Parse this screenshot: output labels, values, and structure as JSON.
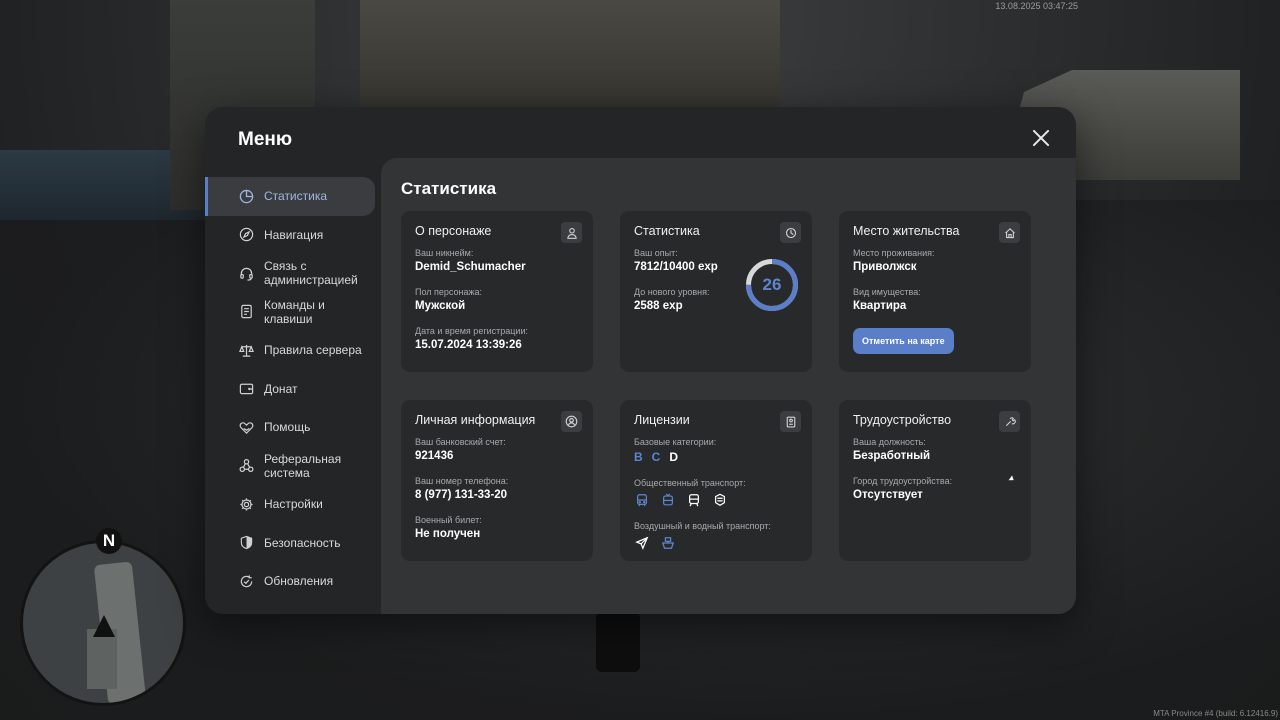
{
  "hud": {
    "datetime": "13.08.2025 03:47:25",
    "build": "MTA Province #4 (build: 6.12416.9)",
    "radar_north": "N"
  },
  "menu": {
    "title": "Меню",
    "sidebar": [
      {
        "label": "Статистика",
        "icon": "pie-chart-icon",
        "active": true
      },
      {
        "label": "Навигация",
        "icon": "compass-icon"
      },
      {
        "label": "Связь с\nадминистрацией",
        "icon": "headset-icon"
      },
      {
        "label": "Команды и\nклавиши",
        "icon": "document-icon"
      },
      {
        "label": "Правила сервера",
        "icon": "scales-icon"
      },
      {
        "label": "Донат",
        "icon": "wallet-icon"
      },
      {
        "label": "Помощь",
        "icon": "handshake-heart-icon"
      },
      {
        "label": "Реферальная\nсистема",
        "icon": "network-icon"
      },
      {
        "label": "Настройки",
        "icon": "gear-icon"
      },
      {
        "label": "Безопасность",
        "icon": "shield-icon"
      },
      {
        "label": "Обновления",
        "icon": "refresh-check-icon"
      }
    ],
    "section_title": "Статистика",
    "cards": {
      "character": {
        "title": "О персонаже",
        "icon": "user-icon",
        "nickname_label": "Ваш никнейм:",
        "nickname": "Demid_Schumacher",
        "gender_label": "Пол персонажа:",
        "gender": "Мужской",
        "reg_label": "Дата и время регистрации:",
        "reg_date": "15.07.2024 13:39:26"
      },
      "stats": {
        "title": "Статистика",
        "icon": "clock-chart-icon",
        "exp_label": "Ваш опыт:",
        "exp": "7812/10400 exp",
        "next_label": "До нового уровня:",
        "next": "2588 exp",
        "level": "26",
        "progress": 0.751
      },
      "residence": {
        "title": "Место жительства",
        "icon": "home-icon",
        "place_label": "Место проживания:",
        "place": "Приволжск",
        "property_label": "Вид имущества:",
        "property": "Квартира",
        "map_button": "Отметить на карте"
      },
      "personal": {
        "title": "Личная информация",
        "icon": "person-circle-icon",
        "bank_label": "Ваш банковский счет:",
        "bank": "921436",
        "phone_label": "Ваш номер телефона:",
        "phone": "8 (977) 131-33-20",
        "military_label": "Военный билет:",
        "military": "Не получен"
      },
      "licenses": {
        "title": "Лицензии",
        "icon": "id-card-icon",
        "base_label": "Базовые категории:",
        "categories": [
          {
            "name": "B",
            "owned": true
          },
          {
            "name": "C",
            "owned": true
          },
          {
            "name": "D",
            "owned": false
          }
        ],
        "public_label": "Общественный транспорт:",
        "public_icons": [
          "bus-icon",
          "trolleybus-icon",
          "tram-icon",
          "metro-icon"
        ],
        "air_label": "Воздушный и водный транспорт:",
        "air_icons": [
          "plane-icon",
          "ship-icon"
        ]
      },
      "employment": {
        "title": "Трудоустройство",
        "icon": "tools-icon",
        "position_label": "Ваша должность:",
        "position": "Безработный",
        "city_label": "Город трудоустройства:",
        "city": "Отсутствует"
      }
    }
  }
}
